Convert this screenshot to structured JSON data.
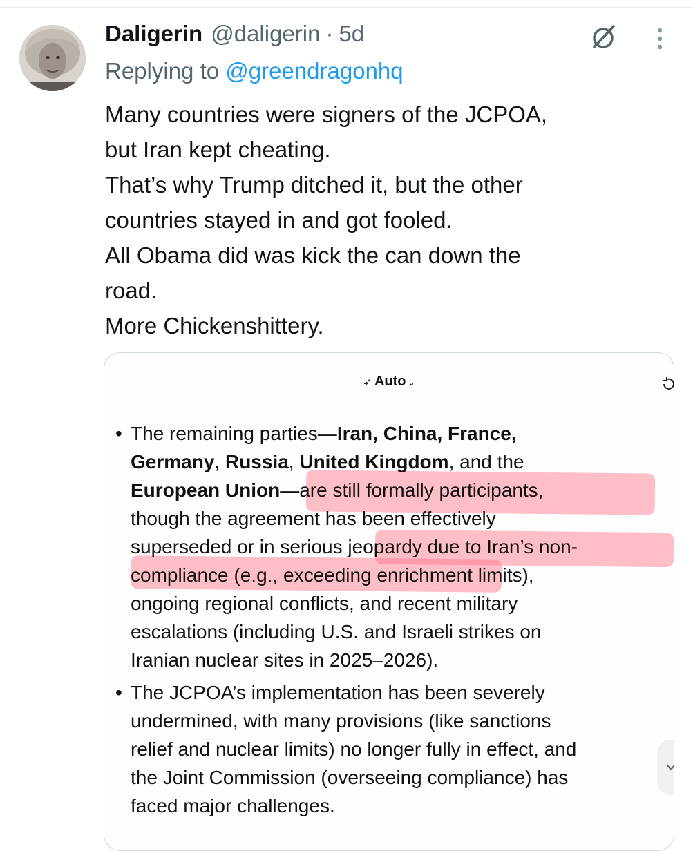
{
  "tweet": {
    "display_name": "Daligerin",
    "handle": "@daligerin",
    "separator": "·",
    "time": "5d",
    "replying_prefix": "Replying to",
    "replying_handle": "@greendragonhq",
    "text_lines": [
      "Many countries were signers of the JCPOA,",
      "but Iran kept cheating.",
      "That’s why Trump ditched it, but the other",
      "countries stayed in and got fooled.",
      "All Obama did was kick the can down the",
      "road.",
      "More Chickenshittery."
    ],
    "icons": [
      "mute-icon",
      "more-vertical-icon"
    ]
  },
  "media": {
    "mode_label": "Auto",
    "mode_icon": "rocket-icon",
    "bullet1": {
      "l1_a": "The remaining parties—",
      "l1_b": "Iran, China, France,",
      "l2_a": "Germany",
      "l2_b": ",",
      "l2_c": "Russia",
      "l2_d": ",",
      "l2_e": "United Kingdom",
      "l2_f": ", and the",
      "l3_a": "European Union",
      "l3_b": "—are still formally participants,",
      "l4": "though the agreement has been effectively",
      "l5": "superseded or in serious jeopardy due to Iran’s non-",
      "l6": "compliance (e.g., exceeding enrichment limits),",
      "l7": "ongoing regional conflicts, and recent military",
      "l8": "escalations (including U.S. and Israeli strikes on",
      "l9": "Iranian nuclear sites in 2025–2026)."
    },
    "bullet2_lines": [
      "The JCPOA’s implementation has been severely",
      "undermined, with many provisions (like sanctions",
      "relief and nuclear limits) no longer fully in effect, and",
      "the Joint Commission (overseeing compliance) has",
      "faced major challenges."
    ],
    "highlight_color": "#ff7087"
  }
}
